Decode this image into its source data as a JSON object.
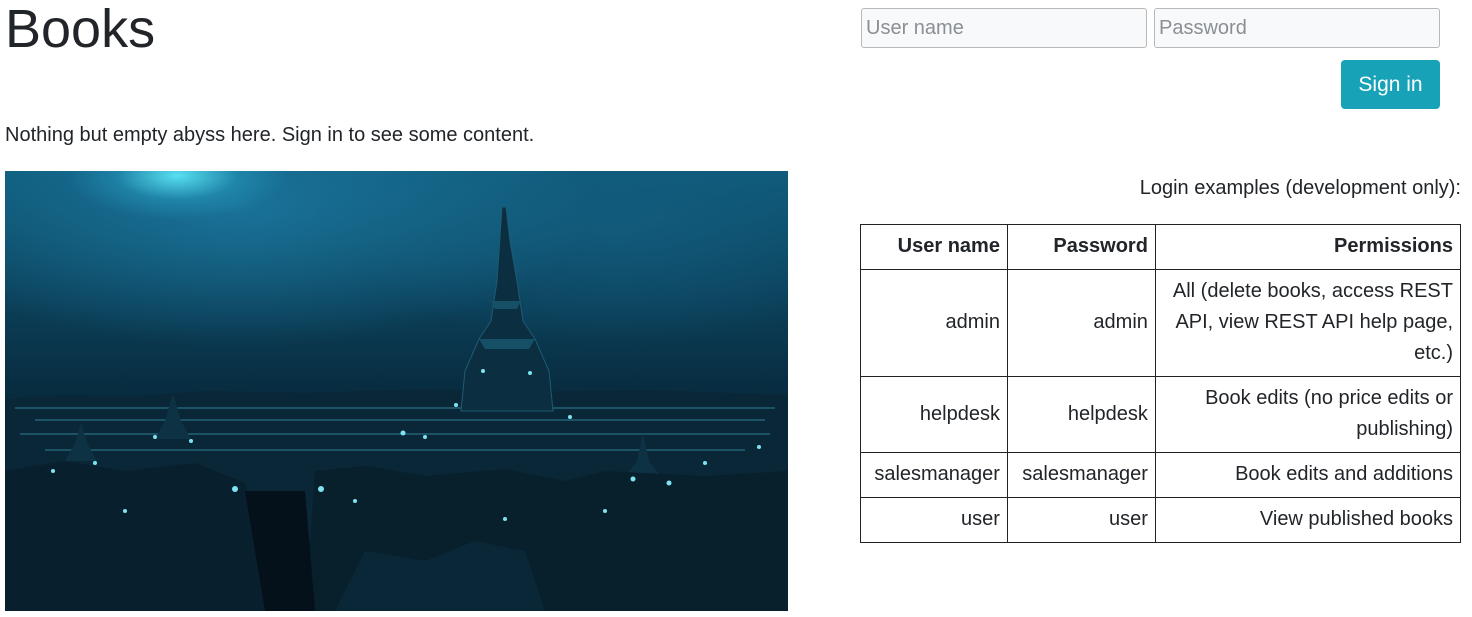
{
  "header": {
    "title": "Books"
  },
  "login": {
    "username_placeholder": "User name",
    "password_placeholder": "Password",
    "signin_label": "Sign in",
    "accent_color": "#17a2b8"
  },
  "main": {
    "empty_message": "Nothing but empty abyss here. Sign in to see some content."
  },
  "examples": {
    "caption": "Login examples (development only):",
    "headers": [
      "User name",
      "Password",
      "Permissions"
    ],
    "rows": [
      [
        "admin",
        "admin",
        "All (delete books, access REST API, view REST API help page, etc.)"
      ],
      [
        "helpdesk",
        "helpdesk",
        "Book edits (no price edits or publishing)"
      ],
      [
        "salesmanager",
        "salesmanager",
        "Book edits and additions"
      ],
      [
        "user",
        "user",
        "View published books"
      ]
    ]
  }
}
